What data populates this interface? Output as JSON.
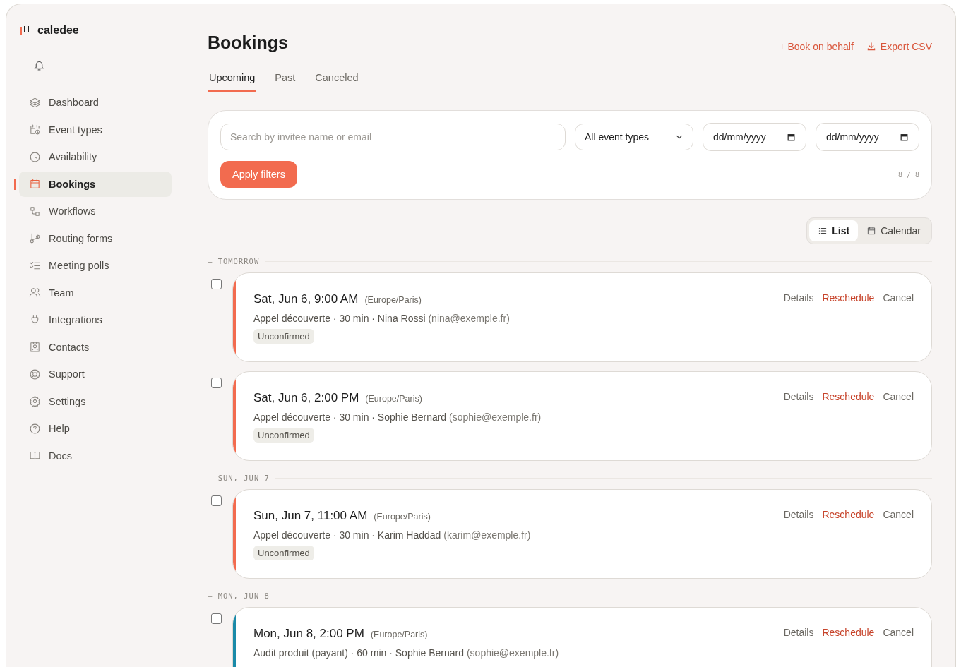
{
  "brand": {
    "name": "caledee"
  },
  "sidebar": {
    "items": [
      {
        "label": "Dashboard",
        "selected": false
      },
      {
        "label": "Event types",
        "selected": false
      },
      {
        "label": "Availability",
        "selected": false
      },
      {
        "label": "Bookings",
        "selected": true
      },
      {
        "label": "Workflows",
        "selected": false
      },
      {
        "label": "Routing forms",
        "selected": false
      },
      {
        "label": "Meeting polls",
        "selected": false
      },
      {
        "label": "Team",
        "selected": false
      },
      {
        "label": "Integrations",
        "selected": false
      },
      {
        "label": "Contacts",
        "selected": false
      },
      {
        "label": "Support",
        "selected": false
      },
      {
        "label": "Settings",
        "selected": false
      },
      {
        "label": "Help",
        "selected": false
      },
      {
        "label": "Docs",
        "selected": false
      }
    ]
  },
  "header": {
    "title": "Bookings",
    "actions": [
      "+ Book on behalf",
      "Export CSV"
    ]
  },
  "tabs": [
    {
      "label": "Upcoming",
      "selected": true
    },
    {
      "label": "Past",
      "selected": false
    },
    {
      "label": "Canceled",
      "selected": false
    }
  ],
  "filters": {
    "search": {
      "placeholder": "Search by invitee name or email"
    },
    "event_type": "All event types",
    "date_from": "dd/mm/yyyy",
    "date_to": "dd/mm/yyyy",
    "apply": "Apply filters",
    "count": "8 / 8"
  },
  "view_toggle": [
    {
      "label": "List",
      "selected": true
    },
    {
      "label": "Calendar",
      "selected": false
    }
  ],
  "groups": [
    {
      "label": "— TOMORROW",
      "bookings": [
        {
          "when": "Sat, Jun 6, 9:00 AM",
          "timezone": "(Europe/Paris)",
          "summary": "Appel découverte · 30 min · Nina Rossi",
          "email": "(nina@exemple.fr)",
          "status": "Unconfirmed",
          "color": "#f26b4f",
          "checked": false,
          "actions": [
            "Details",
            "Reschedule",
            "Cancel"
          ]
        },
        {
          "when": "Sat, Jun 6, 2:00 PM",
          "timezone": "(Europe/Paris)",
          "summary": "Appel découverte · 30 min · Sophie Bernard",
          "email": "(sophie@exemple.fr)",
          "status": "Unconfirmed",
          "color": "#f26b4f",
          "checked": false,
          "actions": [
            "Details",
            "Reschedule",
            "Cancel"
          ]
        }
      ]
    },
    {
      "label": "— SUN, JUN 7",
      "bookings": [
        {
          "when": "Sun, Jun 7, 11:00 AM",
          "timezone": "(Europe/Paris)",
          "summary": "Appel découverte · 30 min · Karim Haddad",
          "email": "(karim@exemple.fr)",
          "status": "Unconfirmed",
          "color": "#f26b4f",
          "checked": false,
          "actions": [
            "Details",
            "Reschedule",
            "Cancel"
          ]
        }
      ]
    },
    {
      "label": "— MON, JUN 8",
      "bookings": [
        {
          "when": "Mon, Jun 8, 2:00 PM",
          "timezone": "(Europe/Paris)",
          "summary": "Audit produit (payant) · 60 min · Sophie Bernard",
          "email": "(sophie@exemple.fr)",
          "color": "#1a8aa8",
          "checked": false,
          "actions": [
            "Details",
            "Reschedule",
            "Cancel"
          ]
        }
      ]
    }
  ]
}
